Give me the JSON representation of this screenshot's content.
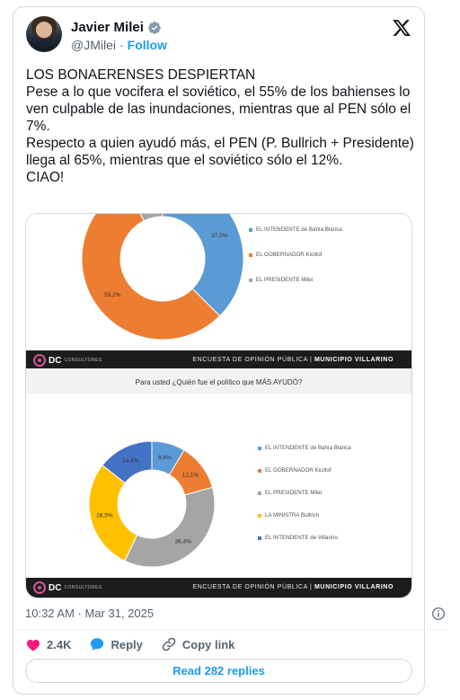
{
  "author": {
    "display_name": "Javier Milei",
    "handle": "@JMilei",
    "separator": "·",
    "follow_label": "Follow"
  },
  "tweet": {
    "text": "LOS BONAERENSES DESPIERTAN\nPese a lo que vocifera el soviético, el 55% de los bahienses lo ven culpable de las inundaciones, mientras que al PEN sólo el 7%.\nRespecto a quien ayudó más, el PEN (P. Bullrich + Presidente) llega al 65%, mientras que el soviético sólo el 12%.\nCIAO!",
    "timestamp": "10:32 AM · Mar 31, 2025"
  },
  "media": {
    "brand": "DC",
    "brand_sub": "CONSULTORES",
    "survey_label": "ENCUESTA DE OPINIÓN PÚBLICA  |",
    "survey_place": "MUNICIPIO VILLARINO",
    "question": "Para usted ¿Quién fue el político que MÁS AYUDÓ?"
  },
  "chart_data": [
    {
      "type": "pie",
      "title": "",
      "slices": [
        {
          "name": "EL INTENDENTE de Bahía Blanca",
          "value": 37.5,
          "label": "37,5%",
          "color": "#5b9bd5"
        },
        {
          "name": "EL GOBERNADOR Kicillof",
          "value": 55.2,
          "label": "55,2%",
          "color": "#ed7d31"
        },
        {
          "name": "EL PRESIDENTE Milei",
          "value": 7.3,
          "label": "",
          "color": "#a5a5a5"
        }
      ],
      "legend_position": "right"
    },
    {
      "type": "pie",
      "title": "Para usted ¿Quién fue el político que MÁS AYUDÓ?",
      "slices": [
        {
          "name": "EL INTENDENTE de Bahía Blanca",
          "value": 8.6,
          "label": "8,6%",
          "color": "#5b9bd5"
        },
        {
          "name": "EL GOBERNADOR Kicillof",
          "value": 12.1,
          "label": "12,1%",
          "color": "#ed7d31"
        },
        {
          "name": "EL PRESIDENTE Milei",
          "value": 36.4,
          "label": "36,4%",
          "color": "#a5a5a5"
        },
        {
          "name": "LA MINISTRA Bullrich",
          "value": 28.5,
          "label": "28,5%",
          "color": "#ffc000"
        },
        {
          "name": "EL INTENDENTE de Villarino",
          "value": 14.4,
          "label": "14,4%",
          "color": "#4472c4"
        }
      ],
      "legend_position": "right"
    }
  ],
  "actions": {
    "likes": "2.4K",
    "reply_label": "Reply",
    "copy_link_label": "Copy link",
    "read_replies_label": "Read 282 replies"
  },
  "colors": {
    "link": "#1d9bf0",
    "like": "#f91880",
    "muted": "#536471"
  }
}
